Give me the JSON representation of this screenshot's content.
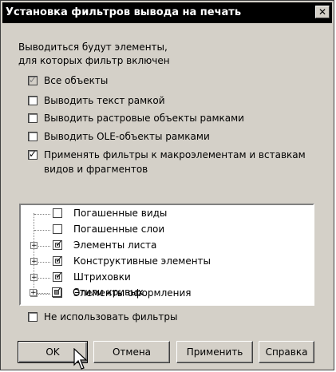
{
  "window": {
    "title": "Установка фильтров вывода на печать",
    "close_glyph": "✕"
  },
  "intro": {
    "line1": "Выводиться будут элементы,",
    "line2": "для которых фильтр включен"
  },
  "options": [
    {
      "label": "Все объекты",
      "checked": true,
      "disabled": true
    },
    {
      "label": "Выводить текст рамкой",
      "checked": false
    },
    {
      "label": "Выводить растровые объекты рамками",
      "checked": false
    },
    {
      "label": "Выводить OLE-объекты рамками",
      "checked": false
    },
    {
      "label_line1": "Применять фильтры  к макроэлементам и вставкам",
      "label_line2": "видов и фрагментов",
      "checked": true
    }
  ],
  "tree": {
    "items": [
      {
        "label": "Погашенные виды",
        "expandable": false,
        "state": "unchecked"
      },
      {
        "label": "Погашенные слои",
        "expandable": false,
        "state": "unchecked"
      },
      {
        "label": "Элементы листа",
        "expandable": true,
        "state": "partial"
      },
      {
        "label": "Конструктивные элементы",
        "expandable": true,
        "state": "partial"
      },
      {
        "label": "Штриховки",
        "expandable": true,
        "state": "partial"
      },
      {
        "label": "Элементы оформления",
        "expandable": true,
        "state": "partial"
      },
      {
        "label": "Стили кривых",
        "expandable": true,
        "state": "partial-dark"
      }
    ],
    "expander_glyph": "+"
  },
  "no_filters": {
    "label": "Не использовать фильтры",
    "checked": false
  },
  "buttons": {
    "ok": "OK",
    "cancel": "Отмена",
    "apply": "Применить",
    "help": "Справка"
  }
}
